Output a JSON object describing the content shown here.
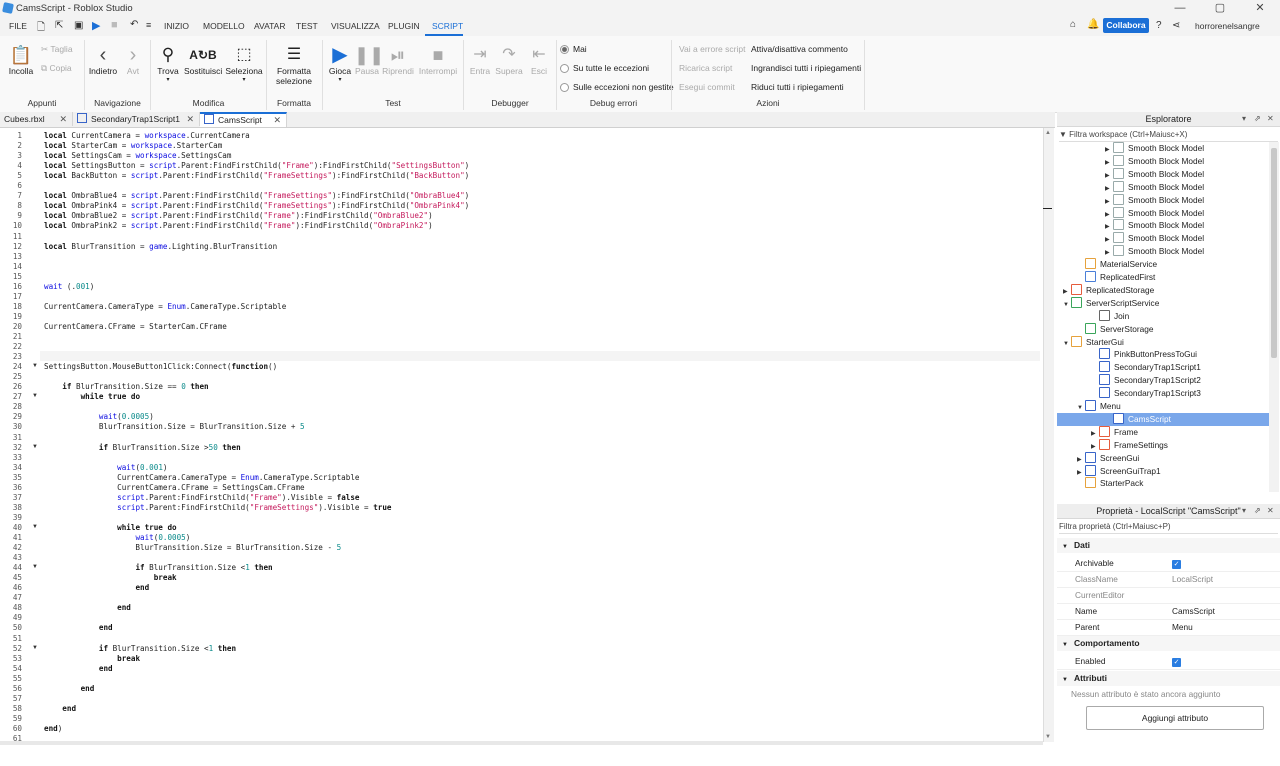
{
  "window": {
    "title": "CamsScript - Roblox Studio",
    "controls": [
      "—",
      "▢",
      "✕"
    ]
  },
  "menu": {
    "items": [
      "FILE",
      "HOME",
      "MODELLO",
      "AVATAR",
      "TEST",
      "VISUALIZZA",
      "PLUGIN",
      "SCRIPT"
    ],
    "labels": {
      "file": "FILE",
      "home": "INIZIO",
      "model": "MODELLO",
      "avatar": "AVATAR",
      "test": "TEST",
      "view": "VISUALIZZA",
      "plugin": "PLUGIN",
      "script": "SCRIPT"
    },
    "collaborate": "Collabora",
    "username": "horrorenelsangre"
  },
  "ribbon": {
    "appunti": {
      "label": "Appunti",
      "paste": "Incolla",
      "cut": "Taglia",
      "copy": "Copia"
    },
    "navigazione": {
      "label": "Navigazione",
      "back": "Indietro",
      "forward": "Avt"
    },
    "modifica": {
      "label": "Modifica",
      "find": "Trova",
      "replace": "Sostituisci",
      "select": "Seleziona"
    },
    "formatta": {
      "label": "Formatta",
      "format_line1": "Formatta",
      "format_line2": "selezione"
    },
    "test": {
      "label": "Test",
      "play": "Gioca",
      "pause": "Pausa",
      "resume": "Riprendi",
      "stop": "Interrompi"
    },
    "debugger": {
      "label": "Debugger",
      "step_in": "Entra",
      "step_over": "Supera",
      "step_out": "Esci"
    },
    "debug_errori": {
      "label": "Debug errori",
      "never": "Mai",
      "all_exceptions": "Su tutte le eccezioni",
      "unhandled": "Sulle eccezioni non gestite"
    },
    "azioni": {
      "label": "Azioni",
      "goto_error": "Vai a errore script",
      "reload": "Ricarica script",
      "exit_script": "Esegui commit",
      "toggle_comment": "Attiva/disattiva commento",
      "expand_all": "Ingrandisci tutti i ripiegamenti",
      "collapse_all": "Riduci tutti i ripiegamenti"
    }
  },
  "tabs": [
    {
      "label": "Cubes.rbxl"
    },
    {
      "label": "SecondaryTrap1Script1"
    },
    {
      "label": "CamsScript"
    }
  ],
  "code": {
    "line_numbers": [
      "1",
      "2",
      "3",
      "4",
      "5",
      "6",
      "7",
      "8",
      "9",
      "10",
      "11",
      "12",
      "13",
      "14",
      "15",
      "16",
      "17",
      "18",
      "19",
      "20",
      "21",
      "22",
      "23",
      "24",
      "25",
      "26",
      "27",
      "28",
      "29",
      "30",
      "31",
      "32",
      "33",
      "34",
      "35",
      "36",
      "37",
      "38",
      "39",
      "40",
      "41",
      "42",
      "43",
      "44",
      "45",
      "46",
      "47",
      "48",
      "49",
      "50",
      "51",
      "52",
      "53",
      "54",
      "55",
      "56",
      "57",
      "58",
      "59",
      "60",
      "61"
    ],
    "lines": [
      "local CurrentCamera = workspace.CurrentCamera",
      "local StarterCam = workspace.StarterCam",
      "local SettingsCam = workspace.SettingsCam",
      "local SettingsButton = script.Parent:FindFirstChild(\"Frame\"):FindFirstChild(\"SettingsButton\")",
      "local BackButton = script.Parent:FindFirstChild(\"FrameSettings\"):FindFirstChild(\"BackButton\")",
      "",
      "local OmbraBlue4 = script.Parent:FindFirstChild(\"FrameSettings\"):FindFirstChild(\"OmbraBlue4\")",
      "local OmbraPink4 = script.Parent:FindFirstChild(\"FrameSettings\"):FindFirstChild(\"OmbraPink4\")",
      "local OmbraBlue2 = script.Parent:FindFirstChild(\"Frame\"):FindFirstChild(\"OmbraBlue2\")",
      "local OmbraPink2 = script.Parent:FindFirstChild(\"Frame\"):FindFirstChild(\"OmbraPink2\")",
      "",
      "local BlurTransition = game.Lighting.BlurTransition",
      "",
      "",
      "",
      "wait (.001)",
      "",
      "CurrentCamera.CameraType = Enum.CameraType.Scriptable",
      "",
      "CurrentCamera.CFrame = StarterCam.CFrame",
      "",
      "",
      "",
      "SettingsButton.MouseButton1Click:Connect(function()",
      "",
      "    if BlurTransition.Size == 0 then",
      "        while true do",
      "",
      "            wait(0.0005)",
      "            BlurTransition.Size = BlurTransition.Size + 5",
      "",
      "            if BlurTransition.Size >50 then",
      "",
      "                wait(0.001)",
      "                CurrentCamera.CameraType = Enum.CameraType.Scriptable",
      "                CurrentCamera.CFrame = SettingsCam.CFrame",
      "                script.Parent:FindFirstChild(\"Frame\").Visible = false",
      "                script.Parent:FindFirstChild(\"FrameSettings\").Visible = true",
      "",
      "                while true do",
      "                    wait(0.0005)",
      "                    BlurTransition.Size = BlurTransition.Size - 5",
      "",
      "                    if BlurTransition.Size <1 then",
      "                        break",
      "                    end",
      "",
      "                end",
      "",
      "            end",
      "",
      "            if BlurTransition.Size <1 then",
      "                break",
      "            end",
      "",
      "        end",
      "",
      "    end",
      "",
      "end)",
      ""
    ]
  },
  "explorer": {
    "title": "Esploratore",
    "filter": "Filtra workspace (Ctrl+Maiusc+X)",
    "items": [
      {
        "label": "Smooth Block Model"
      },
      {
        "label": "Smooth Block Model"
      },
      {
        "label": "Smooth Block Model"
      },
      {
        "label": "Smooth Block Model"
      },
      {
        "label": "Smooth Block Model"
      },
      {
        "label": "Smooth Block Model"
      },
      {
        "label": "Smooth Block Model"
      },
      {
        "label": "Smooth Block Model"
      },
      {
        "label": "Smooth Block Model"
      },
      {
        "label": "MaterialService"
      },
      {
        "label": "ReplicatedFirst"
      },
      {
        "label": "ReplicatedStorage"
      },
      {
        "label": "ServerScriptService"
      },
      {
        "label": "Join"
      },
      {
        "label": "ServerStorage"
      },
      {
        "label": "StarterGui"
      },
      {
        "label": "PinkButtonPressToGui"
      },
      {
        "label": "SecondaryTrap1Script1"
      },
      {
        "label": "SecondaryTrap1Script2"
      },
      {
        "label": "SecondaryTrap1Script3"
      },
      {
        "label": "Menu"
      },
      {
        "label": "CamsScript"
      },
      {
        "label": "Frame"
      },
      {
        "label": "FrameSettings"
      },
      {
        "label": "ScreenGui"
      },
      {
        "label": "ScreenGuiTrap1"
      },
      {
        "label": "StarterPack"
      }
    ]
  },
  "properties": {
    "title": "Proprietà - LocalScript \"CamsScript\"",
    "filter": "Filtra proprietà (Ctrl+Maiusc+P)",
    "cat_data": "Dati",
    "cat_behavior": "Comportamento",
    "cat_attributes": "Attributi",
    "archivable": "Archivable",
    "classname": "ClassName",
    "classname_value": "LocalScript",
    "current_editor": "CurrentEditor",
    "name": "Name",
    "name_value": "CamsScript",
    "parent": "Parent",
    "parent_value": "Menu",
    "enabled": "Enabled",
    "no_attributes": "Nessun attributo è stato ancora aggiunto",
    "add_attribute": "Aggiungi attributo"
  },
  "colors": {
    "accent": "#1b6fd6",
    "keyword": "#0b0be0",
    "string": "#c41a5c",
    "selection": "#7aa7ea"
  }
}
